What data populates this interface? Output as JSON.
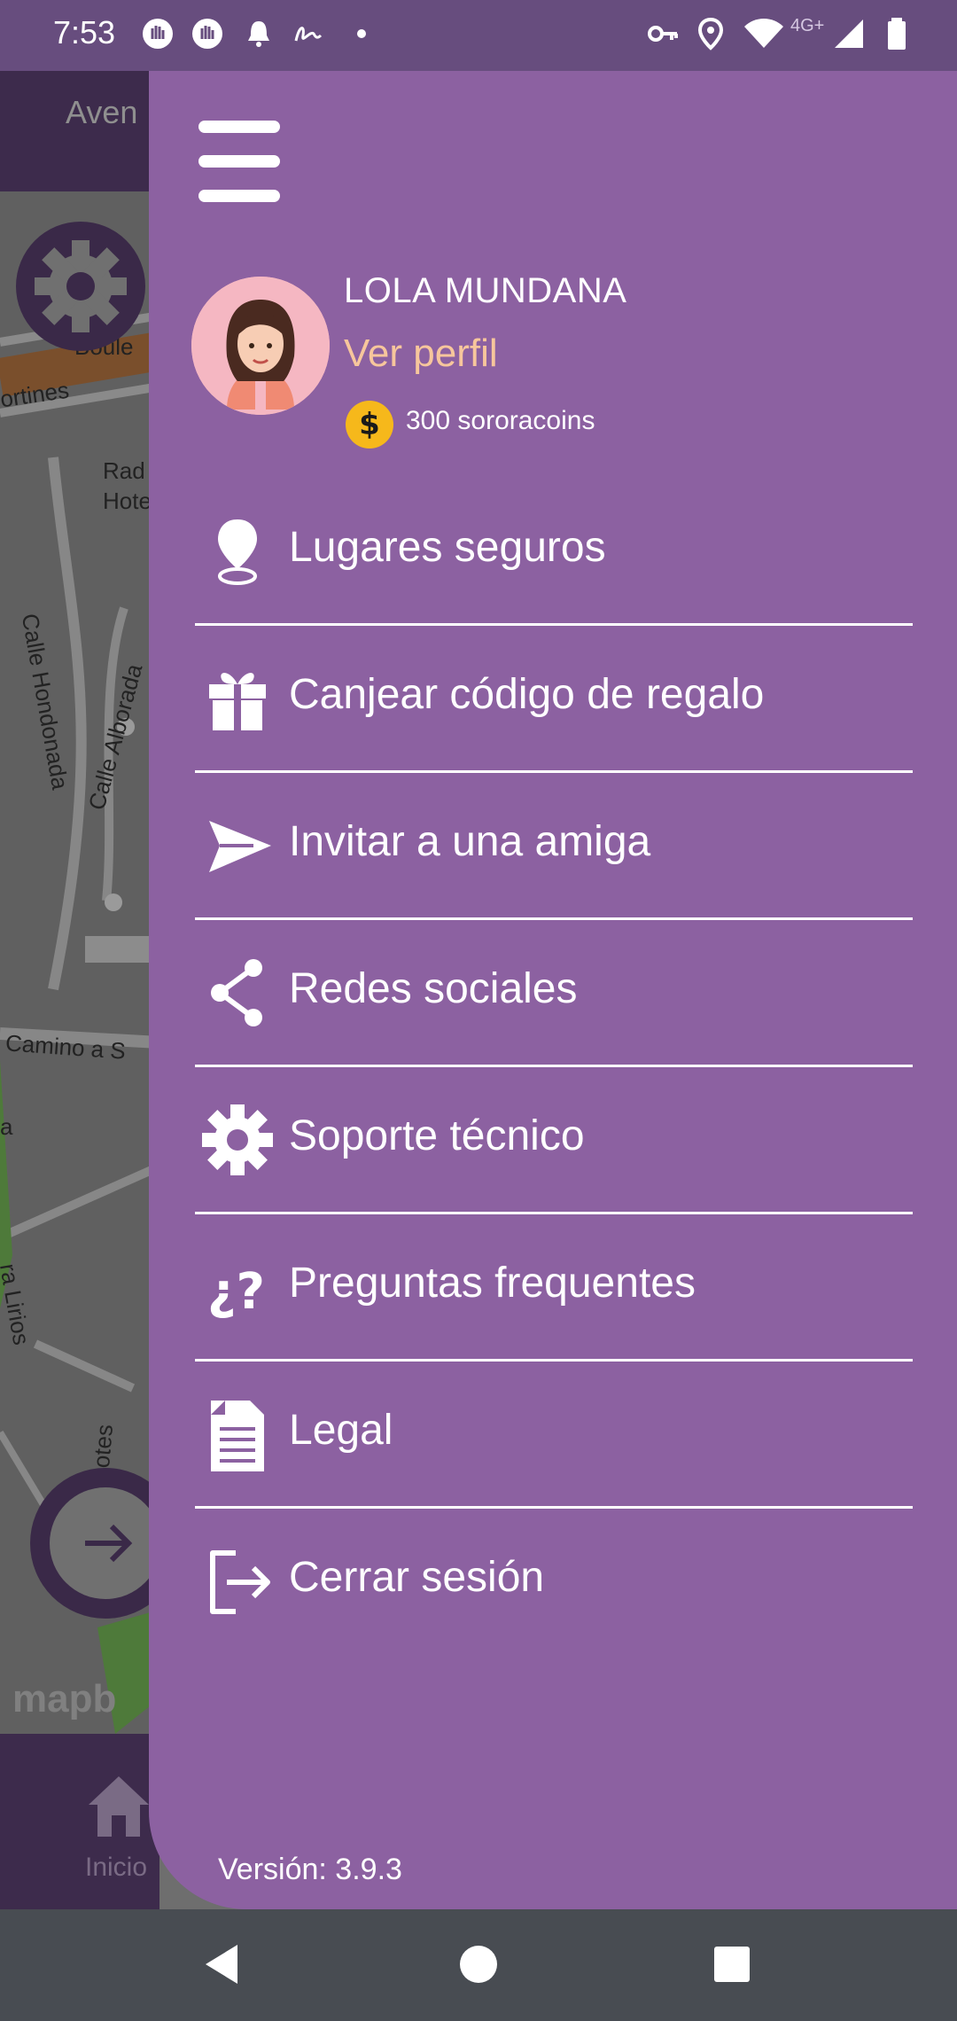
{
  "status_bar": {
    "time": "7:53",
    "network": "4G+",
    "icons": [
      "hand-icon",
      "hand-icon",
      "bell-icon",
      "signature-icon",
      "dot-icon",
      "vpn-key-icon",
      "location-icon",
      "wifi-icon",
      "signal-icon",
      "battery-icon"
    ]
  },
  "background": {
    "header_text": "Aven",
    "map_labels": [
      "Boule",
      "ortines",
      "Rad",
      "Hote",
      "Calle Hondonada",
      "Calle Alborada",
      "Camino a S",
      "a",
      "ra Lirios",
      "otes"
    ],
    "attribution": "mapb",
    "bottom_nav_label": "Inicio"
  },
  "drawer": {
    "user": {
      "name": "LOLA MUNDANA",
      "view_profile": "Ver perfil",
      "coin_symbol": "$",
      "coins": "300 sororacoins"
    },
    "menu": [
      {
        "label": "Lugares seguros",
        "icon": "map-pin-icon"
      },
      {
        "label": "Canjear código de regalo",
        "icon": "gift-icon"
      },
      {
        "label": "Invitar a una amiga",
        "icon": "send-icon"
      },
      {
        "label": "Redes sociales",
        "icon": "share-icon"
      },
      {
        "label": "Soporte técnico",
        "icon": "gear-icon"
      },
      {
        "label": "Preguntas frequentes",
        "icon": "question-icon"
      },
      {
        "label": "Legal",
        "icon": "document-icon"
      },
      {
        "label": "Cerrar sesión",
        "icon": "logout-icon"
      }
    ],
    "version": "Versión: 3.9.3"
  },
  "colors": {
    "drawer_bg": "#8c61a1",
    "status_bar_bg": "#674d7e",
    "accent_profile": "#f7c69c",
    "coin": "#f6b81b"
  }
}
